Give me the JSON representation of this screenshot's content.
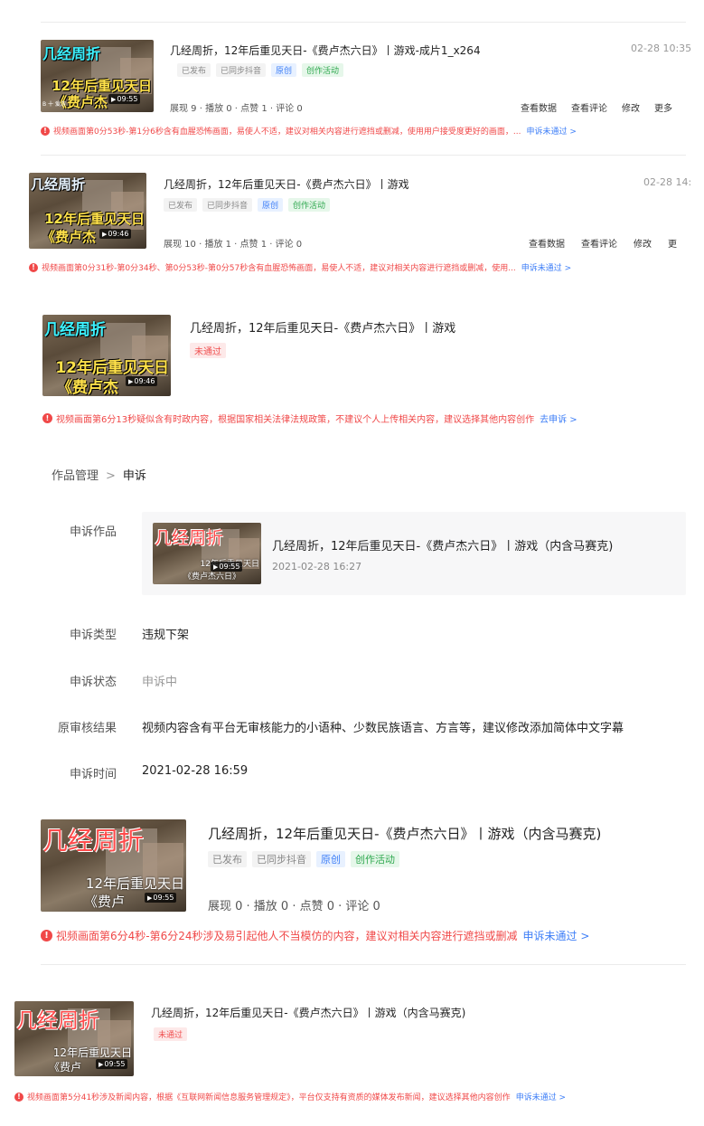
{
  "items": [
    {
      "title": "几经周折，12年后重见天日-《费卢杰六日》丨游戏-成片1_x264",
      "date": "02-28 10:35",
      "tags": [
        "已发布",
        "已同步抖音",
        "原创",
        "创作活动"
      ],
      "duration": "09:55",
      "stats": "展现 9 · 播放 0 · 点赞 1 · 评论 0",
      "actions": [
        "查看数据",
        "查看评论",
        "修改",
        "更多"
      ],
      "warning": "视频画面第0分53秒-第1分6秒含有血腥恐怖画面，易使人不适，建议对相关内容进行遮挡或删减，使用用户接受度更好的画面，...",
      "warning_link": "申诉未通过 >",
      "thumb_title_top": "几经周折",
      "thumb_title_b1": "12年后重见天日",
      "thumb_title_b2": "《费卢杰",
      "thumb_corner": "B 十 爱游"
    },
    {
      "title": "几经周折，12年后重见天日-《费卢杰六日》丨游戏",
      "date": "02-28 14:",
      "tags": [
        "已发布",
        "已同步抖音",
        "原创",
        "创作活动"
      ],
      "duration": "09:46",
      "stats": "展现 10 · 播放 1 · 点赞 1 · 评论 0",
      "actions": [
        "查看数据",
        "查看评论",
        "修改",
        "更"
      ],
      "warning": "视频画面第0分31秒-第0分34秒、第0分53秒-第0分57秒含有血腥恐怖画面，易使人不适，建议对相关内容进行遮挡或删减，使用...",
      "warning_link": "申诉未通过 >",
      "thumb_title_top": "几经周折",
      "thumb_title_b1": "12年后重见天日",
      "thumb_title_b2": "《费卢杰"
    },
    {
      "title": "几经周折，12年后重见天日-《费卢杰六日》丨游戏",
      "tags": [
        "未通过"
      ],
      "duration": "09:46",
      "warning": "视频画面第6分13秒疑似含有时政内容，根据国家相关法律法规政策，不建议个人上传相关内容，建议选择其他内容创作",
      "warning_link": "去申诉 >",
      "thumb_title_top": "几经周折",
      "thumb_title_b1": "12年后重见天日",
      "thumb_title_b2": "《费卢杰"
    }
  ],
  "breadcrumb": {
    "parent": "作品管理",
    "separator": ">",
    "current": "申诉"
  },
  "appeal": {
    "label_work": "申诉作品",
    "work_title": "几经周折，12年后重见天日-《费卢杰六日》丨游戏（内含马赛克)",
    "work_date": "2021-02-28 16:27",
    "work_duration": "09:55",
    "thumb_title_top": "几经周折",
    "thumb_title_b1": "12年后重见天日",
    "thumb_title_b2": "《费卢杰六日》",
    "label_type": "申诉类型",
    "type": "违规下架",
    "label_status": "申诉状态",
    "status": "申诉中",
    "label_result": "原审核结果",
    "result": "视频内容含有平台无审核能力的小语种、少数民族语言、方言等，建议修改添加简体中文字幕",
    "label_time": "申诉时间",
    "time": "2021-02-28 16:59"
  },
  "item4": {
    "title": "几经周折，12年后重见天日-《费卢杰六日》丨游戏（内含马赛克)",
    "tags": [
      "已发布",
      "已同步抖音",
      "原创",
      "创作活动"
    ],
    "duration": "09:55",
    "stats": "展现 0 · 播放 0 · 点赞 0 · 评论 0",
    "warning": "视频画面第6分4秒-第6分24秒涉及易引起他人不当模仿的内容，建议对相关内容进行遮挡或删减",
    "warning_link": "申诉未通过 >",
    "thumb_title_top": "几经周折",
    "thumb_title_b1": "12年后重见天日",
    "thumb_title_b2": "《费卢"
  },
  "item5": {
    "title": "几经周折，12年后重见天日-《费卢杰六日》丨游戏（内含马赛克)",
    "tags": [
      "未通过"
    ],
    "duration": "09:55",
    "warning": "视频画面第5分41秒涉及新闻内容，根据《互联网新闻信息服务管理规定》，平台仅支持有资质的媒体发布新闻，建议选择其他内容创作",
    "warning_link": "申诉未通过 >",
    "thumb_title_top": "几经周折",
    "thumb_title_b1": "12年后重见天日",
    "thumb_title_b2": "《费卢"
  },
  "colors": {
    "warning_red": "#f04848",
    "link_blue": "#3d7ef7",
    "tag_blue": "#3d7ef7",
    "tag_green": "#2fa84f",
    "thumb_title_cyan": "#3df2ff",
    "thumb_subtitle_yellow": "#ffe14a"
  },
  "icons": {
    "warning": "exclamation-circle-icon",
    "play": "play-triangle-icon",
    "chevron": "chevron-right-icon"
  }
}
